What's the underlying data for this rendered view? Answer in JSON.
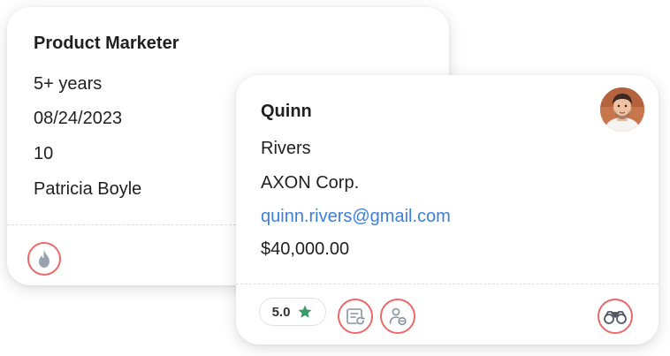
{
  "job_card": {
    "title": "Product Marketer",
    "experience": "5+ years",
    "date": "08/24/2023",
    "count": "10",
    "recruiter": "Patricia Boyle",
    "icons": {
      "hot": "flame-icon"
    }
  },
  "candidate_card": {
    "first_name": "Quinn",
    "last_name": "Rivers",
    "company": "AXON Corp.",
    "email": "quinn.rivers@gmail.com",
    "salary": "$40,000.00",
    "rating": "5.0",
    "icons": {
      "rating": "star-icon",
      "notes": "note-refresh-icon",
      "remove_user": "user-minus-icon",
      "view": "binoculars-icon"
    }
  },
  "colors": {
    "accent_ring": "#ea6a6a",
    "link": "#3d7fdc",
    "star": "#3a9a6a",
    "icon_gray": "#9aa3ad"
  }
}
